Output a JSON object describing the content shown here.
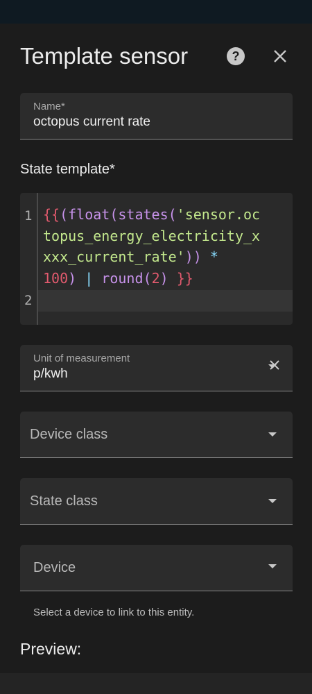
{
  "dialog": {
    "title": "Template sensor",
    "help_icon": "help-circle-icon",
    "close_icon": "close-icon"
  },
  "name_field": {
    "label": "Name*",
    "value": "octopus current rate"
  },
  "state_template": {
    "label": "State template*",
    "line_numbers": [
      "1",
      "2"
    ],
    "code_lines": [
      "{{(float(states('sensor.oc",
      "topus_energy_electricity_x",
      "xxx_current_rate')) *",
      "100) | round(2) }}"
    ]
  },
  "unit_field": {
    "label": "Unit of measurement",
    "value": "p/kwh"
  },
  "device_class": {
    "placeholder": "Device class"
  },
  "state_class": {
    "placeholder": "State class"
  },
  "device": {
    "placeholder": "Device",
    "helper": "Select a device to link to this entity."
  },
  "preview": {
    "label": "Preview:"
  },
  "colors": {
    "background": "#1c1c1c",
    "field_background": "#2c2c2c",
    "code_red": "#e25a6e",
    "code_purple": "#c792ea",
    "code_green": "#c3e88d",
    "code_cyan": "#89ddff"
  }
}
